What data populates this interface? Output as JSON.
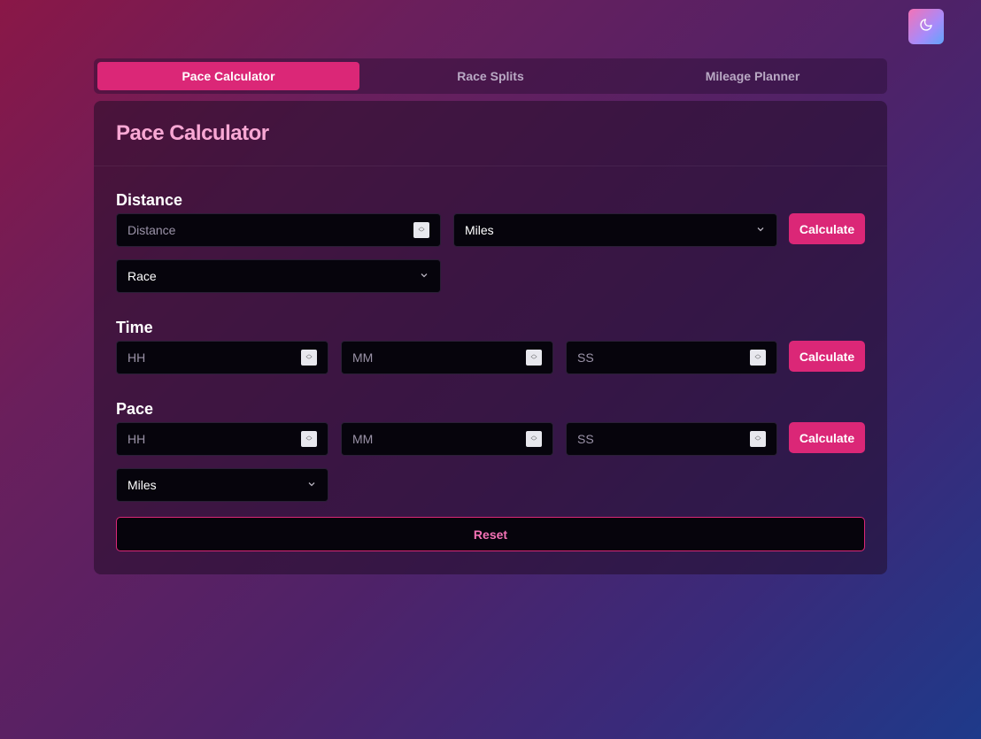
{
  "tabs": [
    {
      "label": "Pace Calculator",
      "active": true
    },
    {
      "label": "Race Splits",
      "active": false
    },
    {
      "label": "Mileage Planner",
      "active": false
    }
  ],
  "theme_toggle": {
    "icon": "moon-icon"
  },
  "card": {
    "title": "Pace Calculator"
  },
  "distance": {
    "label": "Distance",
    "input_placeholder": "Distance",
    "unit_select": "Miles",
    "race_select": "Race",
    "calculate_label": "Calculate"
  },
  "time": {
    "label": "Time",
    "hh_placeholder": "HH",
    "mm_placeholder": "MM",
    "ss_placeholder": "SS",
    "calculate_label": "Calculate"
  },
  "pace": {
    "label": "Pace",
    "hh_placeholder": "HH",
    "mm_placeholder": "MM",
    "ss_placeholder": "SS",
    "calculate_label": "Calculate",
    "unit_select": "Miles"
  },
  "reset_label": "Reset",
  "colors": {
    "accent": "#db2777",
    "title": "#f9a8d4"
  }
}
